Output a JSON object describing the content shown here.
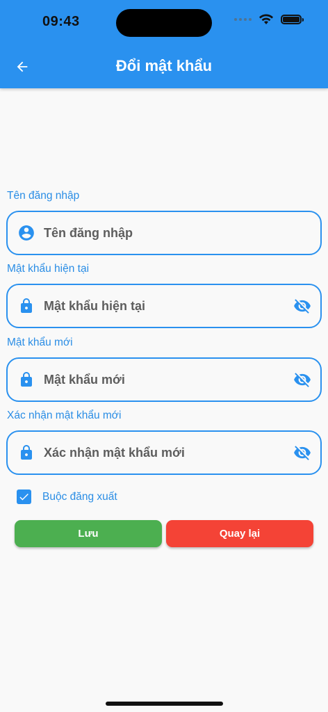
{
  "status_bar": {
    "time": "09:43"
  },
  "header": {
    "title": "Đổi mật khẩu",
    "back_icon": "arrow-left-icon",
    "background_color": "#2a91ef"
  },
  "form": {
    "username": {
      "label": "Tên đăng nhập",
      "placeholder": "Tên đăng nhập",
      "value": "",
      "icon": "account-circle-icon"
    },
    "current_password": {
      "label": "Mật khẩu hiện tại",
      "placeholder": "Mật khẩu hiện tại",
      "value": "",
      "icon": "lock-icon",
      "toggle_icon": "eye-off-icon"
    },
    "new_password": {
      "label": "Mật khẩu mới",
      "placeholder": "Mật khẩu mới",
      "value": "",
      "icon": "lock-icon",
      "toggle_icon": "eye-off-icon"
    },
    "confirm_password": {
      "label": "Xác nhận mật khẩu mới",
      "placeholder": "Xác nhận mật khẩu mới",
      "value": "",
      "icon": "lock-icon",
      "toggle_icon": "eye-off-icon"
    },
    "force_logout": {
      "label": "Buộc đăng xuất",
      "checked": true
    }
  },
  "actions": {
    "save_label": "Lưu",
    "back_label": "Quay lại",
    "save_color": "#4caf50",
    "back_color": "#f44336"
  }
}
